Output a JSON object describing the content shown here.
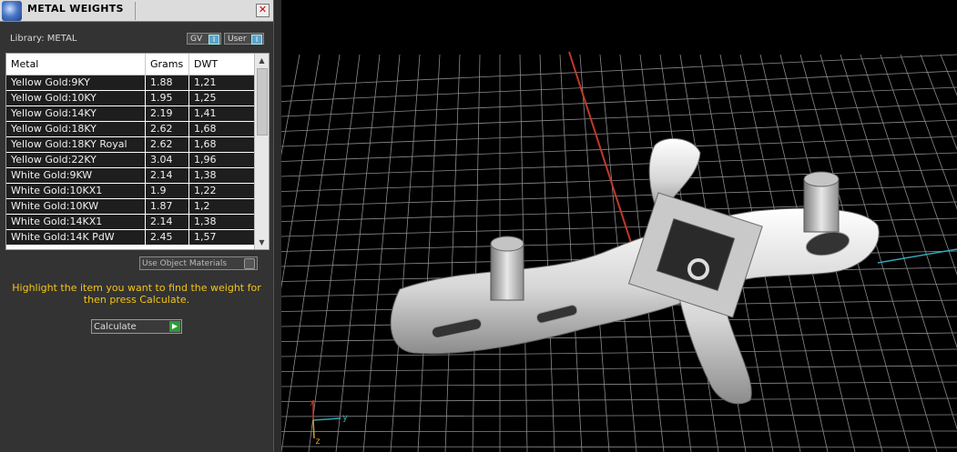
{
  "window": {
    "title": "METAL WEIGHTS"
  },
  "library": {
    "label": "Library: METAL"
  },
  "toggles": {
    "gv": "GV",
    "user": "User"
  },
  "table": {
    "headers": [
      "Metal",
      "Grams",
      "DWT"
    ],
    "rows": [
      {
        "metal": "Yellow Gold:9KY",
        "grams": "1.88",
        "dwt": "1,21"
      },
      {
        "metal": "Yellow Gold:10KY",
        "grams": "1.95",
        "dwt": "1,25"
      },
      {
        "metal": "Yellow Gold:14KY",
        "grams": "2.19",
        "dwt": "1,41"
      },
      {
        "metal": "Yellow Gold:18KY",
        "grams": "2.62",
        "dwt": "1,68"
      },
      {
        "metal": "Yellow Gold:18KY Royal",
        "grams": "2.62",
        "dwt": "1,68"
      },
      {
        "metal": "Yellow Gold:22KY",
        "grams": "3.04",
        "dwt": "1,96"
      },
      {
        "metal": "White Gold:9KW",
        "grams": "2.14",
        "dwt": "1,38"
      },
      {
        "metal": "White Gold:10KX1",
        "grams": "1.9",
        "dwt": "1,22"
      },
      {
        "metal": "White Gold:10KW",
        "grams": "1.87",
        "dwt": "1,2"
      },
      {
        "metal": "White Gold:14KX1",
        "grams": "2.14",
        "dwt": "1,38"
      },
      {
        "metal": "White Gold:14K PdW",
        "grams": "2.45",
        "dwt": "1,57"
      }
    ]
  },
  "use_object_materials": "Use Object Materials",
  "instruction": "Highlight the item you want to find the weight for then press Calculate.",
  "calculate": "Calculate",
  "axes": {
    "x": "x",
    "y": "y",
    "z": "z"
  },
  "colors": {
    "instruction": "#f5c518",
    "grid": "#8a8a8a",
    "x_axis": "#c0392b",
    "y_axis": "#2fa8b8",
    "model": "#e6e6e6"
  }
}
